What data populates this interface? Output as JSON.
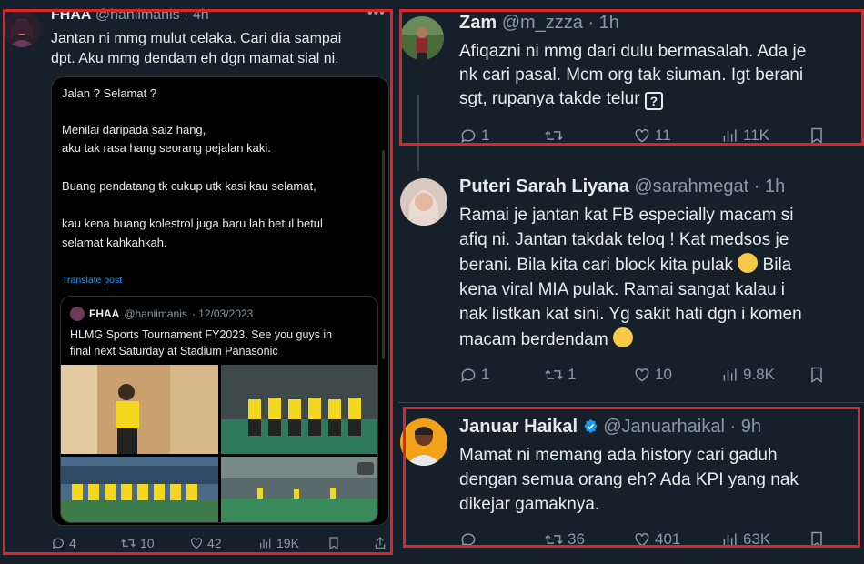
{
  "left_tweet": {
    "name": "FHAA",
    "handle": "@haniimanis",
    "time": "· 4h",
    "line1": "Jantan ni mmg mulut celaka. Cari dia sampai",
    "line2": "dpt. Aku mmg dendam eh dgn mamat sial ni.",
    "card_lines": [
      "Jalan ? Selamat ?",
      "Menilai daripada saiz hang,",
      "aku tak rasa hang seorang pejalan kaki.",
      "Buang pendatang tk cukup utk kasi kau selamat,",
      "kau kena buang kolestrol juga baru lah betul betul",
      "selamat kahkahkah."
    ],
    "translate": "Translate post",
    "quote": {
      "name": "FHAA",
      "handle": "@haniimanis",
      "date": "· 12/03/2023",
      "text_line1": "HLMG Sports Tournament FY2023. See you guys in",
      "text_line2": "final next Saturday at Stadium Panasonic"
    },
    "stats": {
      "replies": "4",
      "reposts": "10",
      "likes": "42",
      "views": "19K"
    }
  },
  "replies": [
    {
      "name": "Zam",
      "handle": "@m_zzza",
      "time": "· 1h",
      "lines": [
        "Afiqazni ni mmg dari dulu bermasalah. Ada je",
        "nk cari pasal. Mcm org tak siuman. Igt berani",
        "sgt, rupanya takde telur"
      ],
      "glyph": "?",
      "stats": {
        "replies": "1",
        "reposts": "",
        "likes": "11",
        "views": "11K"
      }
    },
    {
      "name": "Puteri Sarah Liyana",
      "handle": "@sarahmegat",
      "time": "· 1h",
      "lines": [
        "Ramai je jantan kat FB especially macam si",
        "afiq ni. Jantan takdak teloq ! Kat medsos je",
        "berani. Bila kita cari block kita pulak",
        "kena viral MIA pulak. Ramai sangat kalau i",
        "nak listkan kat sini. Yg sakit hati dgn i komen",
        "macam berdendam"
      ],
      "line3_tail": "Bila",
      "stats": {
        "replies": "1",
        "reposts": "1",
        "likes": "10",
        "views": "9.8K"
      }
    },
    {
      "name": "Januar Haikal",
      "handle": "@Januarhaikal",
      "time": "· 9h",
      "lines": [
        "Mamat ni memang ada history cari gaduh",
        "dengan semua orang eh? Ada KPI yang nak",
        "dikejar gamaknya."
      ],
      "stats": {
        "replies": "",
        "reposts": "36",
        "likes": "401",
        "views": "63K"
      }
    }
  ],
  "colors": {
    "accent": "#1d9bf0",
    "highlight_box": "#d9262b",
    "background": "#15202b"
  }
}
